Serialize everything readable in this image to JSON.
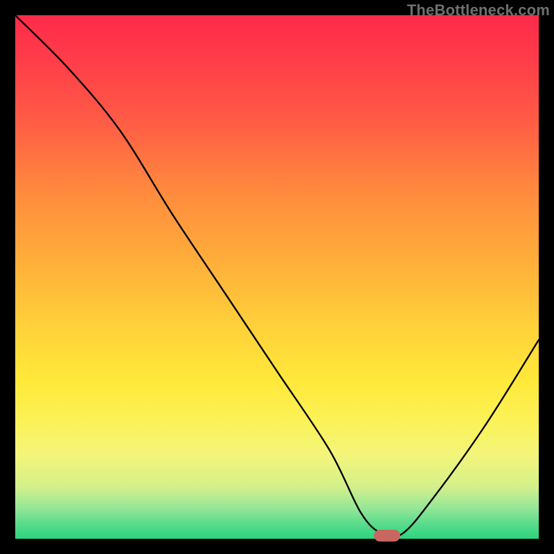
{
  "watermark": "TheBottleneck.com",
  "chart_data": {
    "type": "line",
    "title": "",
    "xlabel": "",
    "ylabel": "",
    "xlim": [
      0,
      100
    ],
    "ylim": [
      0,
      100
    ],
    "grid": false,
    "legend": false,
    "background_gradient": {
      "direction": "vertical",
      "top_color": "#ff2a4a",
      "bottom_color": "#2bd47e",
      "meaning": "top=worst (red), bottom=best (green)"
    },
    "series": [
      {
        "name": "bottleneck-curve",
        "x": [
          0,
          10,
          20,
          30,
          40,
          50,
          60,
          66,
          70,
          74,
          80,
          90,
          100
        ],
        "y": [
          100,
          90,
          78,
          62,
          47,
          32,
          17,
          5,
          1,
          1,
          8,
          22,
          38
        ]
      }
    ],
    "marker": {
      "name": "optimal-point",
      "x": 71,
      "y": 0,
      "color": "#c9665f"
    }
  }
}
